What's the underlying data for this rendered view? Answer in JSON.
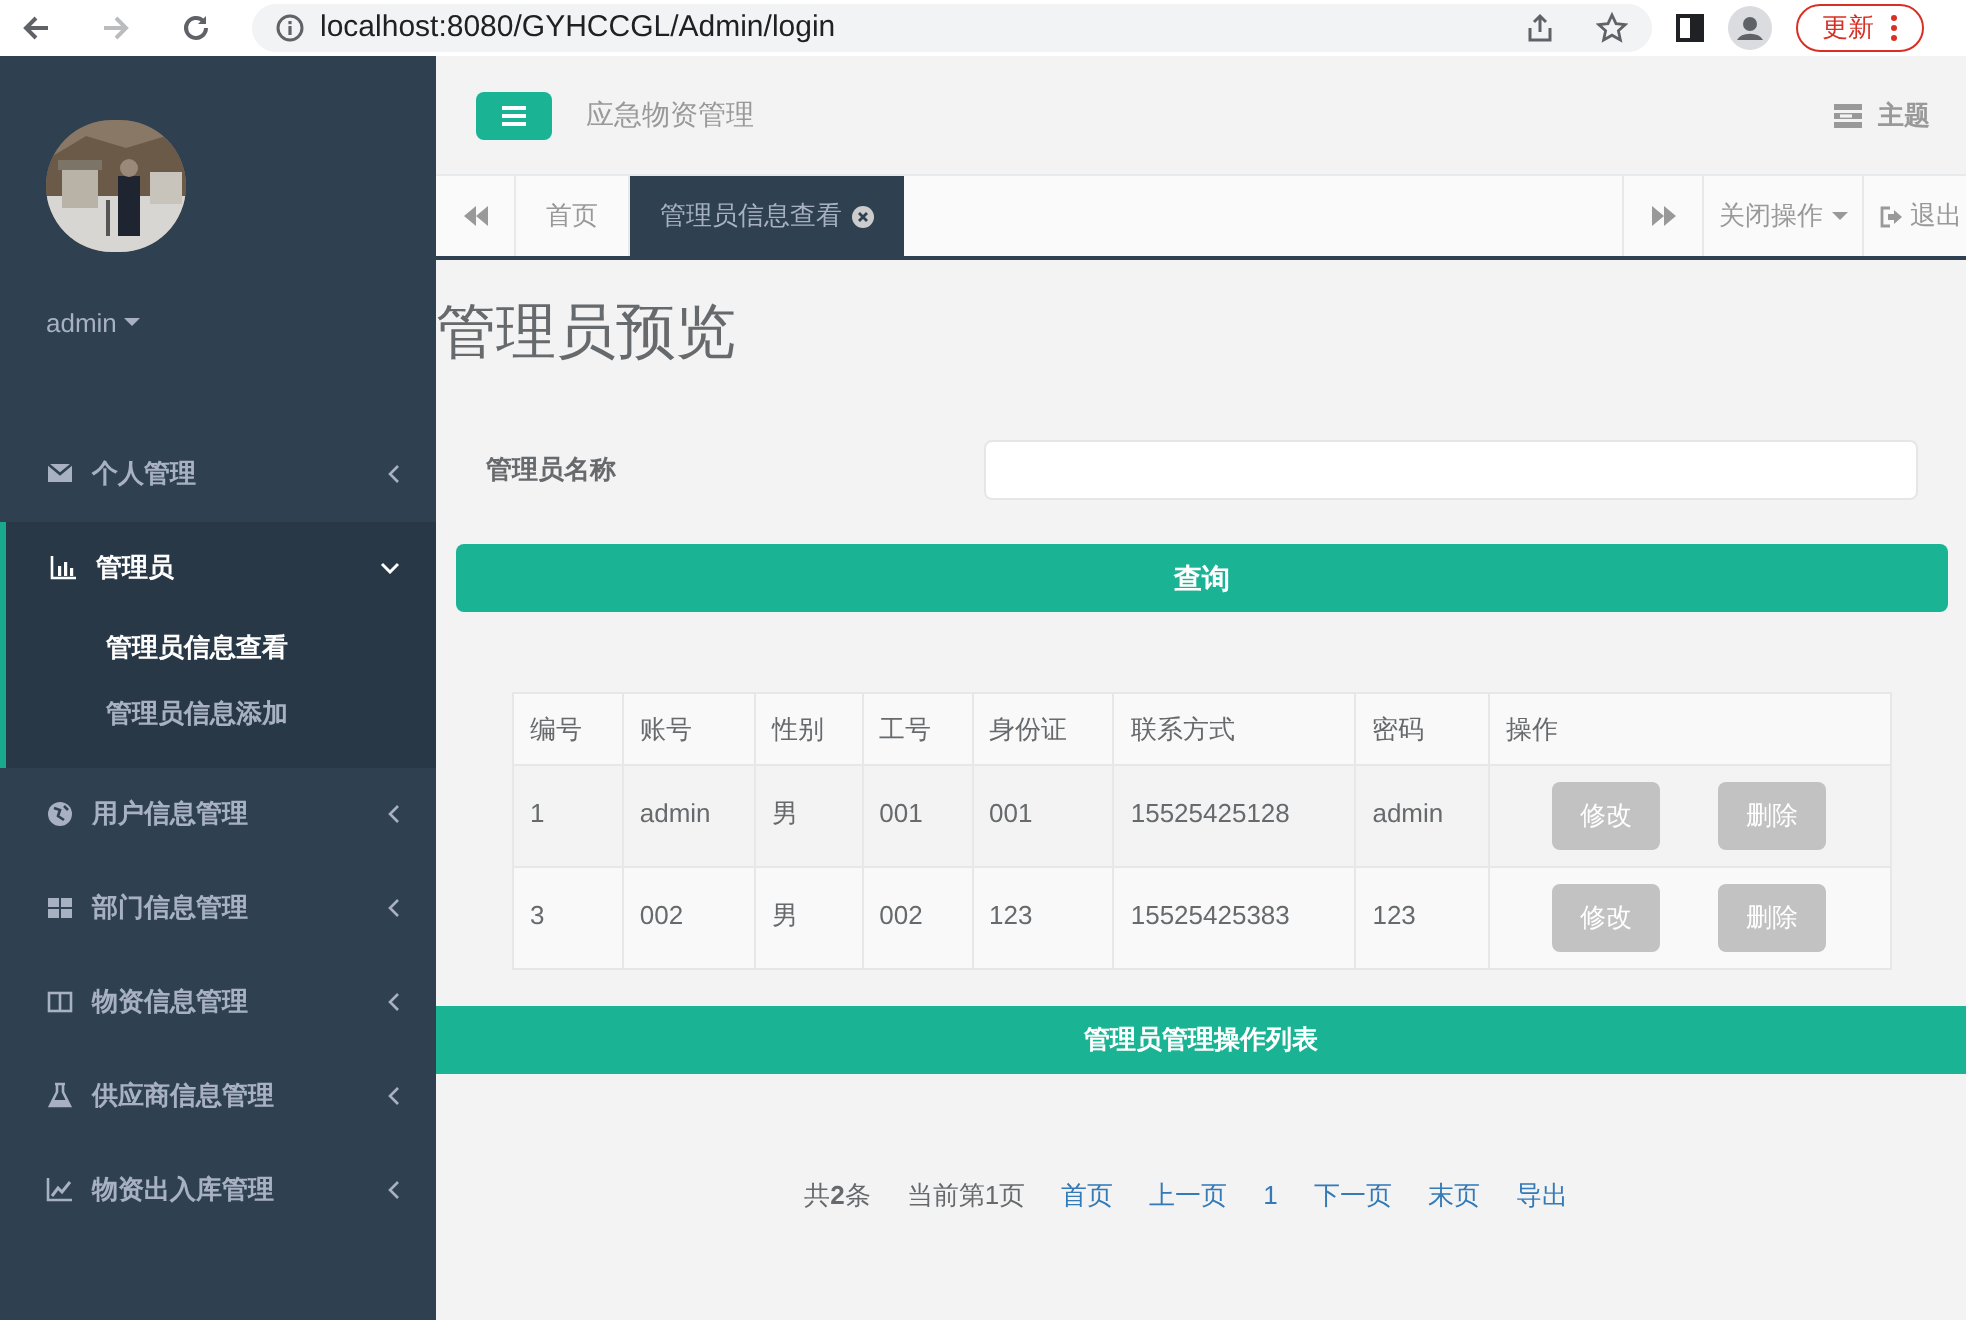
{
  "browser": {
    "url": "localhost:8080/GYHCCGL/Admin/login",
    "update_button": "更新"
  },
  "sidebar": {
    "user": "admin",
    "menu": [
      {
        "label": "个人管理",
        "expanded": false,
        "selected": false
      },
      {
        "label": "管理员",
        "expanded": true,
        "selected": true,
        "children": [
          {
            "label": "管理员信息查看",
            "selected": true
          },
          {
            "label": "管理员信息添加",
            "selected": false
          }
        ]
      },
      {
        "label": "用户信息管理",
        "expanded": false,
        "selected": false
      },
      {
        "label": "部门信息管理",
        "expanded": false,
        "selected": false
      },
      {
        "label": "物资信息管理",
        "expanded": false,
        "selected": false
      },
      {
        "label": "供应商信息管理",
        "expanded": false,
        "selected": false
      },
      {
        "label": "物资出入库管理",
        "expanded": false,
        "selected": false
      }
    ]
  },
  "header": {
    "title": "应急物资管理",
    "theme": "主题"
  },
  "tabs": [
    {
      "label": "首页",
      "selected": false,
      "closable": false
    },
    {
      "label": "管理员信息查看",
      "selected": true,
      "closable": true
    }
  ],
  "tab_actions": {
    "close_menu": "关闭操作",
    "logout": "退出"
  },
  "page_title": "管理员预览",
  "search": {
    "label": "管理员名称"
  },
  "query_button": "查询",
  "table": {
    "columns": [
      "编号",
      "账号",
      "性别",
      "工号",
      "身份证",
      "联系方式",
      "密码",
      "操作"
    ],
    "rows": [
      {
        "cells": [
          "1",
          "admin",
          "男",
          "001",
          "001",
          "15525425128",
          "admin"
        ],
        "actions": [
          "修改",
          "删除"
        ]
      },
      {
        "cells": [
          "3",
          "002",
          "男",
          "002",
          "123",
          "15525425383",
          "123"
        ],
        "actions": [
          "修改",
          "删除"
        ]
      }
    ]
  },
  "banner": "管理员管理操作列表",
  "pagination": [
    {
      "kind": "text",
      "label": "共**2**条"
    },
    {
      "kind": "text",
      "label": "当前第1页"
    },
    {
      "kind": "link",
      "label": "首页"
    },
    {
      "kind": "link",
      "label": "上一页"
    },
    {
      "kind": "link",
      "label": "1"
    },
    {
      "kind": "link",
      "label": "下一页"
    },
    {
      "kind": "link",
      "label": "末页"
    },
    {
      "kind": "link",
      "label": "导出"
    }
  ]
}
